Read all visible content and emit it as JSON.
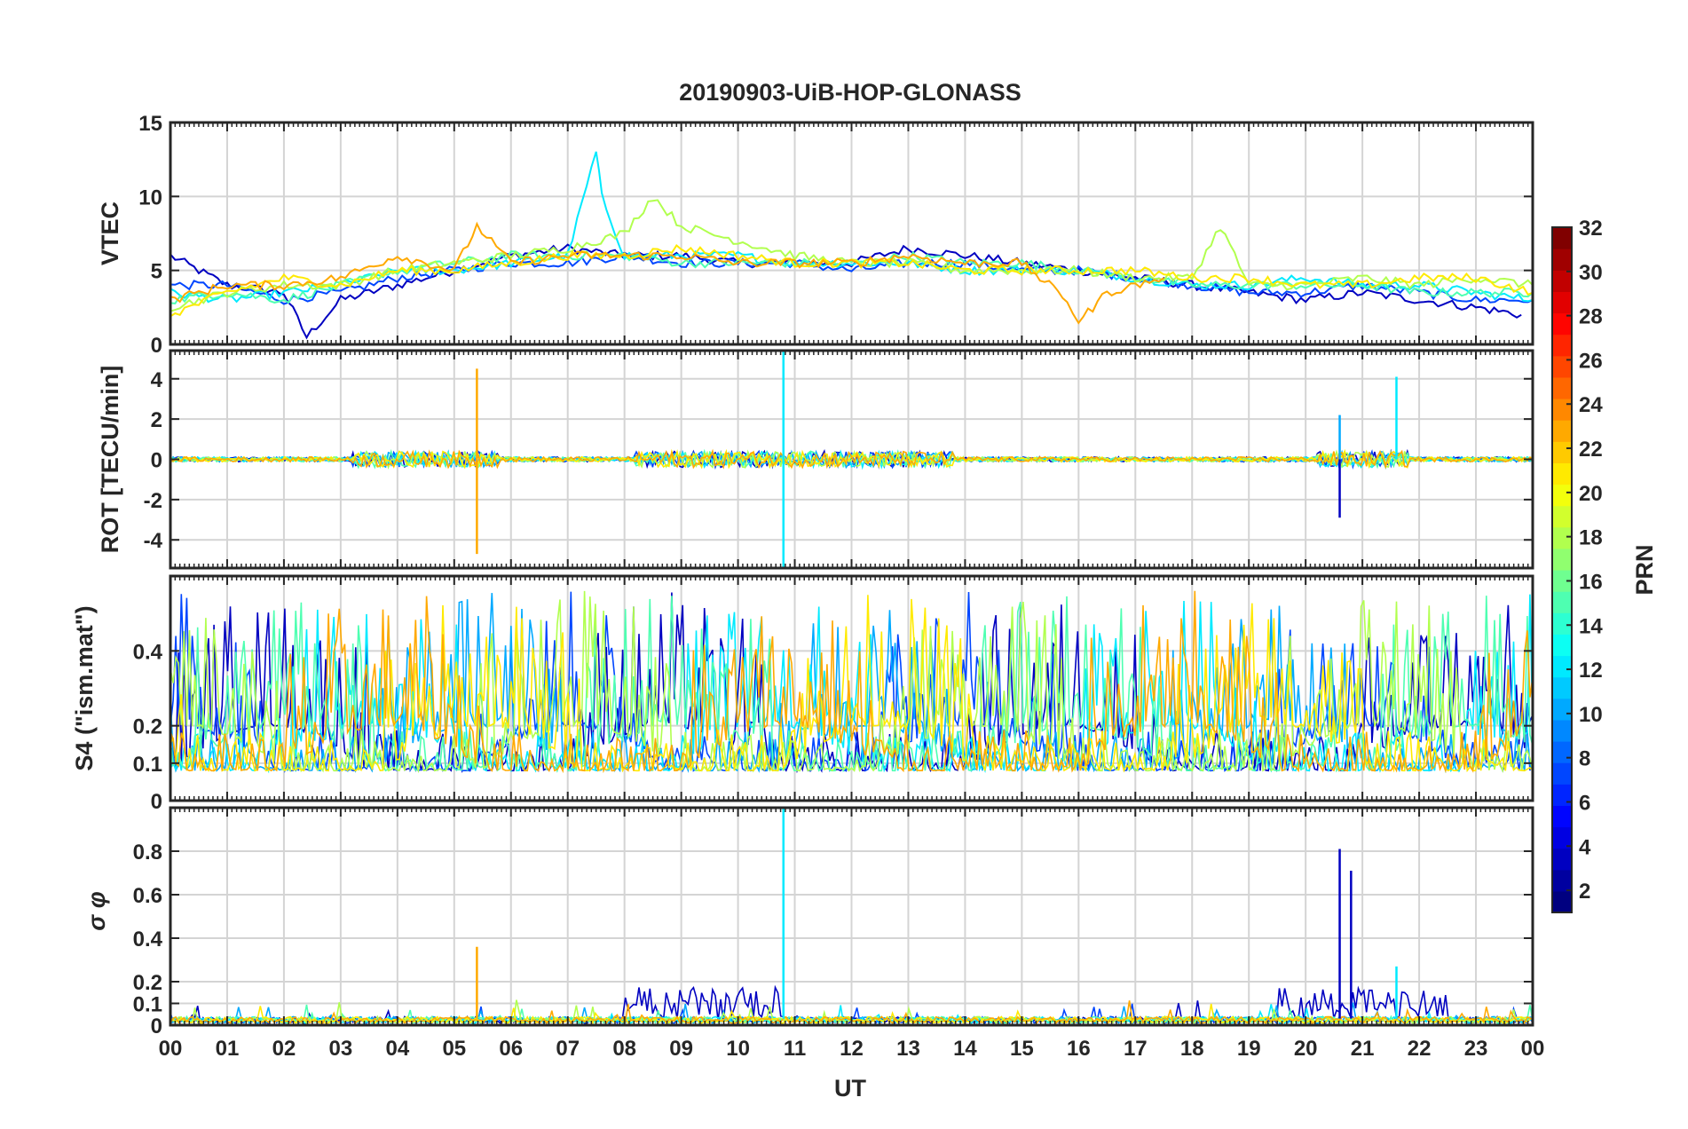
{
  "title": "20190903-UiB-HOP-GLONASS",
  "xlabel": "UT",
  "x_ticks": [
    "00",
    "01",
    "02",
    "03",
    "04",
    "05",
    "06",
    "07",
    "08",
    "09",
    "10",
    "11",
    "12",
    "13",
    "14",
    "15",
    "16",
    "17",
    "18",
    "19",
    "20",
    "21",
    "22",
    "23",
    "00"
  ],
  "colorbar": {
    "label": "PRN",
    "ticks": [
      "2",
      "4",
      "6",
      "8",
      "10",
      "12",
      "14",
      "16",
      "18",
      "20",
      "22",
      "24",
      "26",
      "28",
      "30",
      "32"
    ],
    "range": [
      1,
      32
    ],
    "colormap": "jet"
  },
  "chart_data": [
    {
      "type": "line",
      "panel": "VTEC",
      "ylabel": "VTEC",
      "ylim": [
        0,
        15
      ],
      "y_ticks": [
        "0",
        "5",
        "10",
        "15"
      ],
      "x_range_hours": [
        0,
        24
      ],
      "grid": true,
      "series": [
        {
          "prn": 3,
          "x": [
            0,
            1,
            2,
            2.4,
            3,
            4,
            5,
            6,
            7,
            8,
            9,
            10,
            11,
            12,
            13,
            14,
            15,
            16,
            17,
            18,
            19,
            20,
            21,
            22,
            23,
            23.8
          ],
          "y": [
            6,
            4,
            3.5,
            0.5,
            3,
            4,
            5,
            6,
            6.5,
            6,
            6,
            5.5,
            5.5,
            5.5,
            6.5,
            6,
            5.5,
            5,
            4.5,
            4,
            3.5,
            3,
            3.5,
            3,
            2.5,
            2
          ]
        },
        {
          "prn": 7,
          "x": [
            0,
            1,
            2,
            3,
            4,
            5,
            6,
            7,
            8,
            9,
            10,
            11,
            12,
            13,
            14,
            15,
            16,
            17,
            18,
            19,
            20,
            21,
            22,
            23,
            24
          ],
          "y": [
            4,
            4,
            3,
            3.5,
            4.5,
            5,
            5.5,
            5.5,
            6,
            5.5,
            5.5,
            5.5,
            5,
            5.5,
            5.5,
            5,
            5,
            4.5,
            4,
            3.5,
            3.5,
            4,
            3.5,
            3,
            3
          ]
        },
        {
          "prn": 12,
          "x": [
            0,
            1,
            2,
            3,
            4,
            5,
            6,
            7,
            7.5,
            7.6,
            8,
            9,
            10,
            11,
            12,
            13,
            14,
            15,
            16,
            17,
            18,
            19,
            20,
            21,
            22,
            23,
            24
          ],
          "y": [
            3.5,
            3,
            3.5,
            4,
            5,
            5,
            5.5,
            6,
            13,
            10,
            6,
            6,
            6,
            5.5,
            5.5,
            5.5,
            5,
            5,
            5,
            4.5,
            4,
            4,
            4.5,
            4,
            4,
            3.5,
            3
          ]
        },
        {
          "prn": 15,
          "x": [
            0,
            1,
            2,
            3,
            4,
            5,
            6,
            7,
            8,
            9,
            10,
            11,
            12,
            13,
            14,
            15,
            16,
            17,
            18,
            19,
            20,
            21,
            22,
            23,
            24
          ],
          "y": [
            3,
            3.5,
            3,
            4,
            5,
            5.5,
            6,
            6,
            6,
            5.5,
            5.5,
            5.5,
            5.5,
            6,
            5.5,
            5.5,
            5,
            4.5,
            4,
            4,
            4,
            4,
            3.5,
            3.5,
            3.5
          ]
        },
        {
          "prn": 18,
          "x": [
            0,
            1,
            2,
            3,
            4,
            5,
            6,
            7,
            8,
            8.5,
            9,
            10,
            11,
            12,
            13,
            14,
            15,
            16,
            17,
            18,
            18.5,
            19,
            20,
            21,
            22,
            23,
            24
          ],
          "y": [
            2.5,
            3.5,
            4,
            4,
            5,
            5.5,
            6,
            6.5,
            7.5,
            10,
            8,
            7,
            6,
            5.5,
            5.5,
            5,
            5,
            5,
            4.5,
            4.5,
            8,
            4,
            4,
            4.5,
            4,
            4.5,
            4
          ]
        },
        {
          "prn": 21,
          "x": [
            0,
            1,
            2,
            3,
            4,
            5,
            6,
            7,
            8,
            9,
            10,
            11,
            12,
            13,
            14,
            15,
            16,
            17,
            18,
            19,
            20,
            21,
            22,
            23,
            24
          ],
          "y": [
            2,
            3.5,
            4.5,
            4,
            5,
            5,
            5.5,
            6,
            6,
            6.5,
            6,
            5.5,
            5.5,
            5.5,
            5,
            5,
            5,
            5,
            4.5,
            4.5,
            4,
            4,
            4.5,
            4.5,
            3.5
          ]
        },
        {
          "prn": 23,
          "x": [
            0,
            1,
            2,
            3,
            4,
            5,
            5.4,
            6,
            7,
            8,
            9,
            10,
            11,
            12,
            13,
            14,
            15,
            15.8,
            16,
            16.5,
            17,
            17.5
          ],
          "y": [
            3,
            4,
            4,
            4.5,
            6,
            5,
            8,
            5.5,
            6,
            6,
            6,
            5.5,
            5.5,
            5.5,
            6,
            5.5,
            5.5,
            3,
            1.5,
            3.5,
            4,
            4.5
          ]
        }
      ]
    },
    {
      "type": "line",
      "panel": "ROT",
      "ylabel": "ROT [TECU/min]",
      "ylim": [
        -5.4,
        5.4
      ],
      "y_ticks": [
        "-4",
        "-2",
        "0",
        "2",
        "4"
      ],
      "x_range_hours": [
        0,
        24
      ],
      "grid": true,
      "notable_peaks": [
        {
          "x": 5.4,
          "y": 4.5,
          "prn": 23
        },
        {
          "x": 5.4,
          "y": -4.7,
          "prn": 23
        },
        {
          "x": 10.8,
          "y": 5.4,
          "prn": 12
        },
        {
          "x": 10.8,
          "y": -5.4,
          "prn": 12
        },
        {
          "x": 20.6,
          "y": 2.2,
          "prn": 10
        },
        {
          "x": 20.6,
          "y": -2.9,
          "prn": 3
        },
        {
          "x": 21.6,
          "y": 4.1,
          "prn": 12
        }
      ],
      "baseline": 0,
      "typical_amplitude": 0.4
    },
    {
      "type": "line",
      "panel": "S4",
      "ylabel": "S4 (\"ism.mat\")",
      "ylim": [
        0,
        0.6
      ],
      "y_ticks": [
        "0",
        "0.1",
        "0.2",
        "0.4"
      ],
      "x_range_hours": [
        0,
        24
      ],
      "grid": true,
      "baseline": 0.08,
      "typical_peak": 0.45
    },
    {
      "type": "line",
      "panel": "sigma_phi",
      "ylabel": "σ φ",
      "ylim": [
        0,
        1
      ],
      "y_ticks": [
        "0",
        "0.1",
        "0.2",
        "0.4",
        "0.6",
        "0.8"
      ],
      "x_range_hours": [
        0,
        24
      ],
      "grid": true,
      "notable_peaks": [
        {
          "x": 5.4,
          "y": 0.36,
          "prn": 23
        },
        {
          "x": 10.8,
          "y": 1.0,
          "prn": 12
        },
        {
          "x": 20.6,
          "y": 0.81,
          "prn": 3
        },
        {
          "x": 20.8,
          "y": 0.71,
          "prn": 3
        },
        {
          "x": 21.6,
          "y": 0.27,
          "prn": 12
        }
      ],
      "baseline": 0.03
    }
  ]
}
